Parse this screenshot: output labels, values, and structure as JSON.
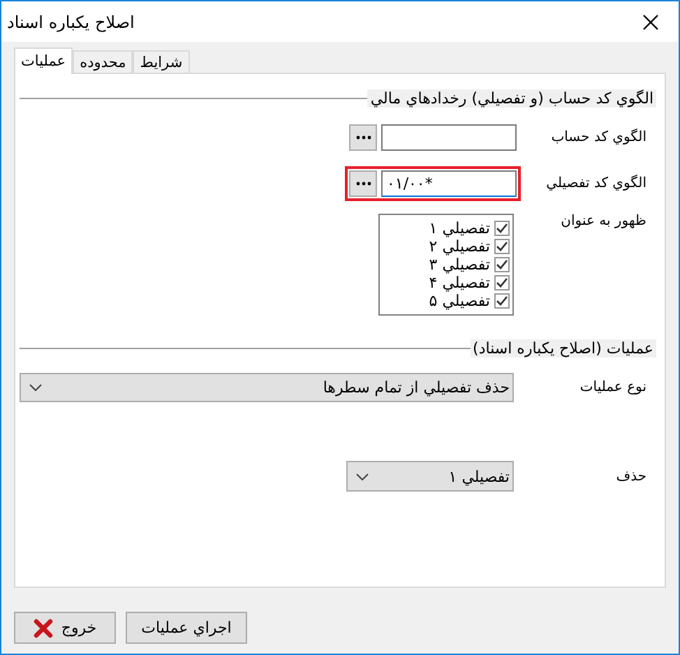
{
  "window": {
    "title": "اصلاح يکباره اسناد"
  },
  "tabs": [
    {
      "label": "شرايط",
      "selected": false
    },
    {
      "label": "محدوده",
      "selected": false
    },
    {
      "label": "عمليات",
      "selected": true
    }
  ],
  "pattern_section": {
    "title": "الگوي کد حساب (و تفصيلي) رخدادهاي مالي",
    "fields": [
      {
        "label": "الگوي کد حساب",
        "highlighted": false
      },
      {
        "label": "الگوي کد تفصيلي",
        "value": "٠١/٠٠*",
        "highlighted": true
      }
    ],
    "appear_as": {
      "label": "ظهور به عنوان",
      "items": [
        {
          "label": "تفصيلي ۱",
          "checked": true
        },
        {
          "label": "تفصيلي ۲",
          "checked": true
        },
        {
          "label": "تفصيلي ۳",
          "checked": true
        },
        {
          "label": "تفصيلي ۴",
          "checked": true
        },
        {
          "label": "تفصيلي ۵",
          "checked": true
        }
      ]
    }
  },
  "operations_section": {
    "title": "عمليات (اصلاح يکباره اسناد)",
    "operation_type": {
      "label": "نوع عمليات",
      "value": "حذف تفصيلي از تمام سطرها"
    },
    "delete": {
      "label": "حذف",
      "value": "تفصيلي ۱"
    }
  },
  "buttons": [
    {
      "kind": "run",
      "label": "اجراي عمليات"
    },
    {
      "kind": "exit",
      "label": "خروج"
    }
  ]
}
